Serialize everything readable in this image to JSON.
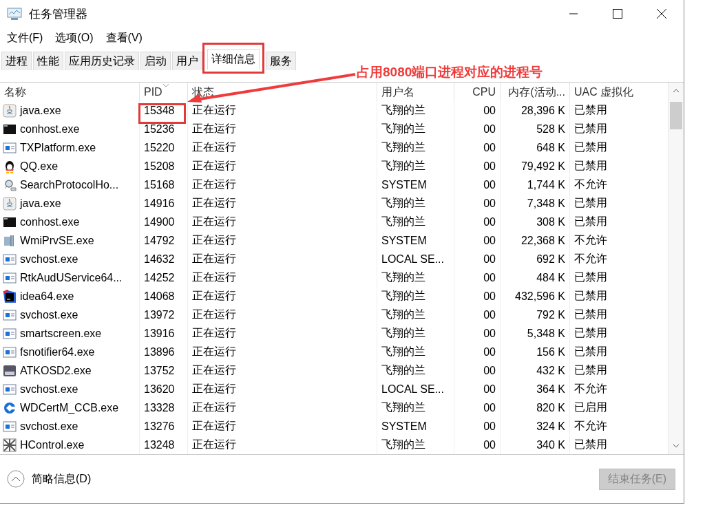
{
  "window": {
    "title": "任务管理器"
  },
  "menu": [
    "文件(F)",
    "选项(O)",
    "查看(V)"
  ],
  "tabs": [
    {
      "label": "进程",
      "selected": false
    },
    {
      "label": "性能",
      "selected": false
    },
    {
      "label": "应用历史记录",
      "selected": false
    },
    {
      "label": "启动",
      "selected": false
    },
    {
      "label": "用户",
      "selected": false
    },
    {
      "label": "详细信息",
      "selected": true
    },
    {
      "label": "服务",
      "selected": false
    }
  ],
  "table": {
    "columns": [
      "名称",
      "PID",
      "状态",
      "用户名",
      "CPU",
      "内存(活动...",
      "UAC 虚拟化"
    ],
    "rows": [
      {
        "kind": "java",
        "cells": [
          "java.exe",
          "15348",
          "正在运行",
          "飞翔的兰",
          "00",
          "28,396 K",
          "已禁用"
        ]
      },
      {
        "kind": "console",
        "cells": [
          "conhost.exe",
          "15236",
          "正在运行",
          "飞翔的兰",
          "00",
          "528 K",
          "已禁用"
        ]
      },
      {
        "kind": "window",
        "cells": [
          "TXPlatform.exe",
          "15220",
          "正在运行",
          "飞翔的兰",
          "00",
          "648 K",
          "已禁用"
        ]
      },
      {
        "kind": "penguin",
        "cells": [
          "QQ.exe",
          "15208",
          "正在运行",
          "飞翔的兰",
          "00",
          "79,492 K",
          "已禁用"
        ]
      },
      {
        "kind": "search",
        "cells": [
          "SearchProtocolHo...",
          "15168",
          "正在运行",
          "SYSTEM",
          "00",
          "1,744 K",
          "不允许"
        ]
      },
      {
        "kind": "java",
        "cells": [
          "java.exe",
          "14916",
          "正在运行",
          "飞翔的兰",
          "00",
          "7,348 K",
          "已禁用"
        ]
      },
      {
        "kind": "console",
        "cells": [
          "conhost.exe",
          "14900",
          "正在运行",
          "飞翔的兰",
          "00",
          "308 K",
          "已禁用"
        ]
      },
      {
        "kind": "service",
        "cells": [
          "WmiPrvSE.exe",
          "14792",
          "正在运行",
          "SYSTEM",
          "00",
          "22,368 K",
          "不允许"
        ]
      },
      {
        "kind": "window",
        "cells": [
          "svchost.exe",
          "14632",
          "正在运行",
          "LOCAL SE...",
          "00",
          "692 K",
          "不允许"
        ]
      },
      {
        "kind": "window",
        "cells": [
          "RtkAudUService64...",
          "14252",
          "正在运行",
          "飞翔的兰",
          "00",
          "484 K",
          "已禁用"
        ]
      },
      {
        "kind": "ide",
        "cells": [
          "idea64.exe",
          "14068",
          "正在运行",
          "飞翔的兰",
          "00",
          "432,596 K",
          "已禁用"
        ]
      },
      {
        "kind": "window",
        "cells": [
          "svchost.exe",
          "13972",
          "正在运行",
          "飞翔的兰",
          "00",
          "792 K",
          "已禁用"
        ]
      },
      {
        "kind": "window",
        "cells": [
          "smartscreen.exe",
          "13916",
          "正在运行",
          "飞翔的兰",
          "00",
          "5,348 K",
          "已禁用"
        ]
      },
      {
        "kind": "window",
        "cells": [
          "fsnotifier64.exe",
          "13896",
          "正在运行",
          "飞翔的兰",
          "00",
          "156 K",
          "已禁用"
        ]
      },
      {
        "kind": "osd",
        "cells": [
          "ATKOSD2.exe",
          "13752",
          "正在运行",
          "飞翔的兰",
          "00",
          "432 K",
          "已禁用"
        ]
      },
      {
        "kind": "window",
        "cells": [
          "svchost.exe",
          "13620",
          "正在运行",
          "LOCAL SE...",
          "00",
          "364 K",
          "不允许"
        ]
      },
      {
        "kind": "ring",
        "cells": [
          "WDCertM_CCB.exe",
          "13328",
          "正在运行",
          "飞翔的兰",
          "00",
          "820 K",
          "已启用"
        ]
      },
      {
        "kind": "window",
        "cells": [
          "svchost.exe",
          "13276",
          "正在运行",
          "SYSTEM",
          "00",
          "324 K",
          "不允许"
        ]
      },
      {
        "kind": "grid",
        "cells": [
          "HControl.exe",
          "13248",
          "正在运行",
          "飞翔的兰",
          "00",
          "340 K",
          "已禁用"
        ]
      }
    ]
  },
  "footer": {
    "toggle": "简略信息(D)",
    "end_task": {
      "label": "结束任务(E)",
      "disabled": true
    }
  },
  "annotation": {
    "text": "占用8080端口进程对应的进程号"
  }
}
